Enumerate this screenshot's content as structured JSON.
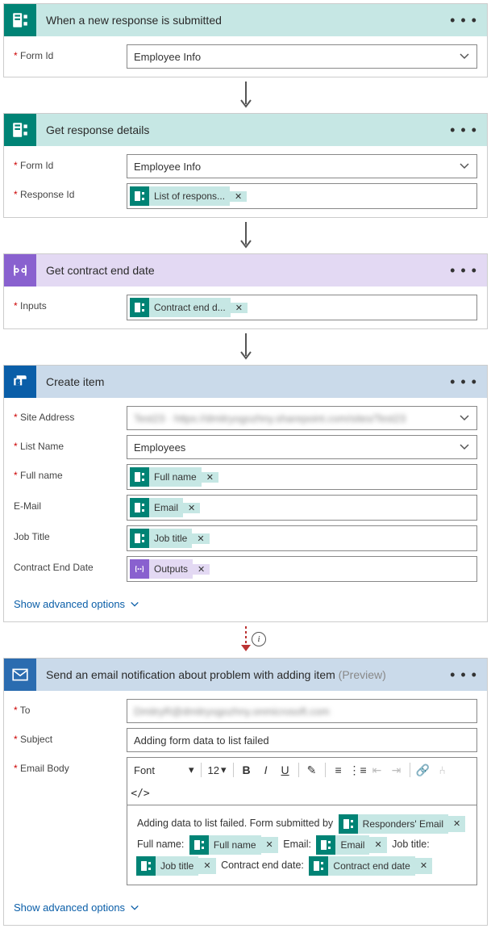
{
  "common": {
    "menu": "• • •",
    "advanced": "Show advanced options"
  },
  "card1": {
    "title": "When a new response is submitted",
    "formIdLabel": "Form Id",
    "formIdValue": "Employee Info"
  },
  "card2": {
    "title": "Get response details",
    "formIdLabel": "Form Id",
    "formIdValue": "Employee Info",
    "responseIdLabel": "Response Id",
    "token": "List of respons..."
  },
  "card3": {
    "title": "Get contract end date",
    "inputsLabel": "Inputs",
    "token": "Contract end d..."
  },
  "card4": {
    "title": "Create item",
    "siteLabel": "Site Address",
    "siteValue": "Test23 · https://dmitryogozhny.sharepoint.com/sites/Test23",
    "listLabel": "List Name",
    "listValue": "Employees",
    "fullNameLabel": "Full name",
    "fullNameToken": "Full name",
    "emailLabel": "E-Mail",
    "emailToken": "Email",
    "jobLabel": "Job Title",
    "jobToken": "Job title",
    "contractLabel": "Contract End Date",
    "contractToken": "Outputs"
  },
  "card5": {
    "title": "Send an email notification about problem with adding item",
    "preview": "(Preview)",
    "toLabel": "To",
    "toValue": "DmitryR@dmitryogozhny.onmicrosoft.com",
    "subjectLabel": "Subject",
    "subjectValue": "Adding form data to list failed",
    "bodyLabel": "Email Body",
    "fontLabel": "Font",
    "sizeLabel": "12",
    "bodyText1": "Adding data to list failed. Form submitted by",
    "tkResp": "Responders' Email",
    "lblFull": "Full name:",
    "tkFull": "Full name",
    "lblEmail": "Email:",
    "tkEmail": "Email",
    "lblJob": "Job title:",
    "tkJob": "Job title",
    "lblContract": "Contract end date:",
    "tkContract": "Contract end date"
  }
}
